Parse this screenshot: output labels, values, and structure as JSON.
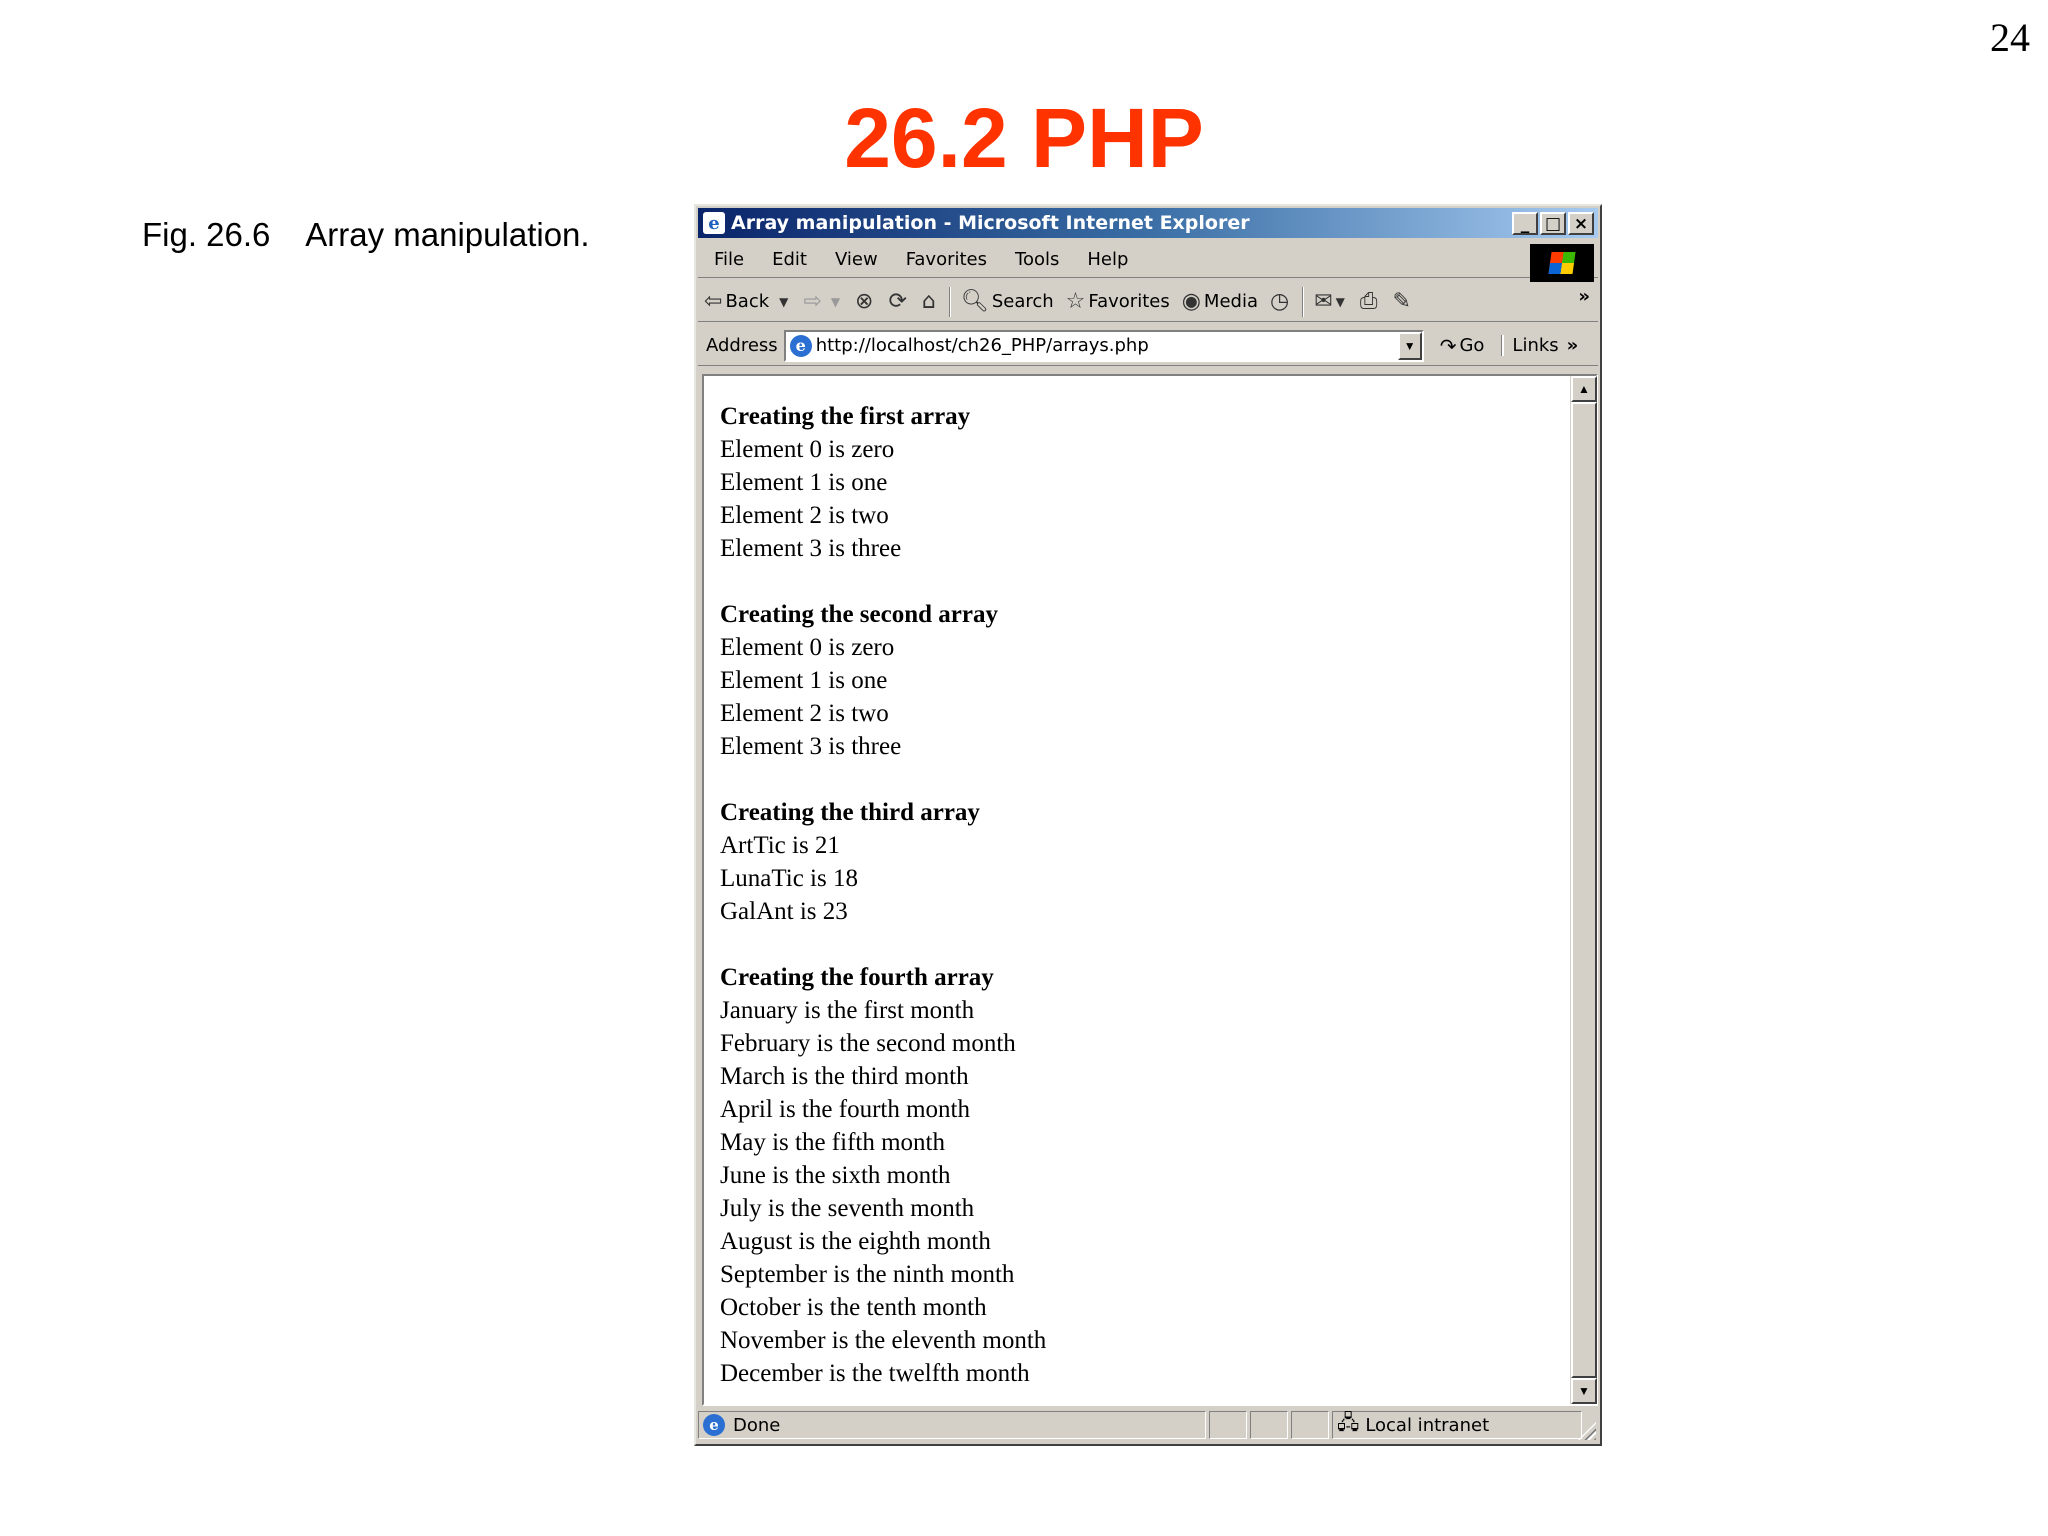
{
  "slide": {
    "page_number": "24",
    "title": "26.2 PHP",
    "caption": "Fig. 26.6    Array manipulation."
  },
  "browser": {
    "window_title": "Array manipulation - Microsoft Internet Explorer",
    "menu": [
      "File",
      "Edit",
      "View",
      "Favorites",
      "Tools",
      "Help"
    ],
    "toolbar": {
      "back": "Back",
      "search": "Search",
      "favorites": "Favorites",
      "media": "Media"
    },
    "address": {
      "label": "Address",
      "url": "http://localhost/ch26_PHP/arrays.php",
      "go": "Go",
      "links": "Links"
    },
    "status": {
      "text": "Done",
      "zone": "Local intranet"
    }
  },
  "content": {
    "sections": [
      {
        "heading": "Creating the first array",
        "lines": [
          "Element 0 is zero",
          "Element 1 is one",
          "Element 2 is two",
          "Element 3 is three"
        ]
      },
      {
        "heading": "Creating the second array",
        "lines": [
          "Element 0 is zero",
          "Element 1 is one",
          "Element 2 is two",
          "Element 3 is three"
        ]
      },
      {
        "heading": "Creating the third array",
        "lines": [
          "ArtTic is 21",
          "LunaTic is 18",
          "GalAnt is 23"
        ]
      },
      {
        "heading": "Creating the fourth array",
        "lines": [
          "January is the first month",
          "February is the second month",
          "March is the third month",
          "April is the fourth month",
          "May is the fifth month",
          "June is the sixth month",
          "July is the seventh month",
          "August is the eighth month",
          "September is the ninth month",
          "October is the tenth month",
          "November is the eleventh month",
          "December is the twelfth month"
        ]
      }
    ]
  }
}
